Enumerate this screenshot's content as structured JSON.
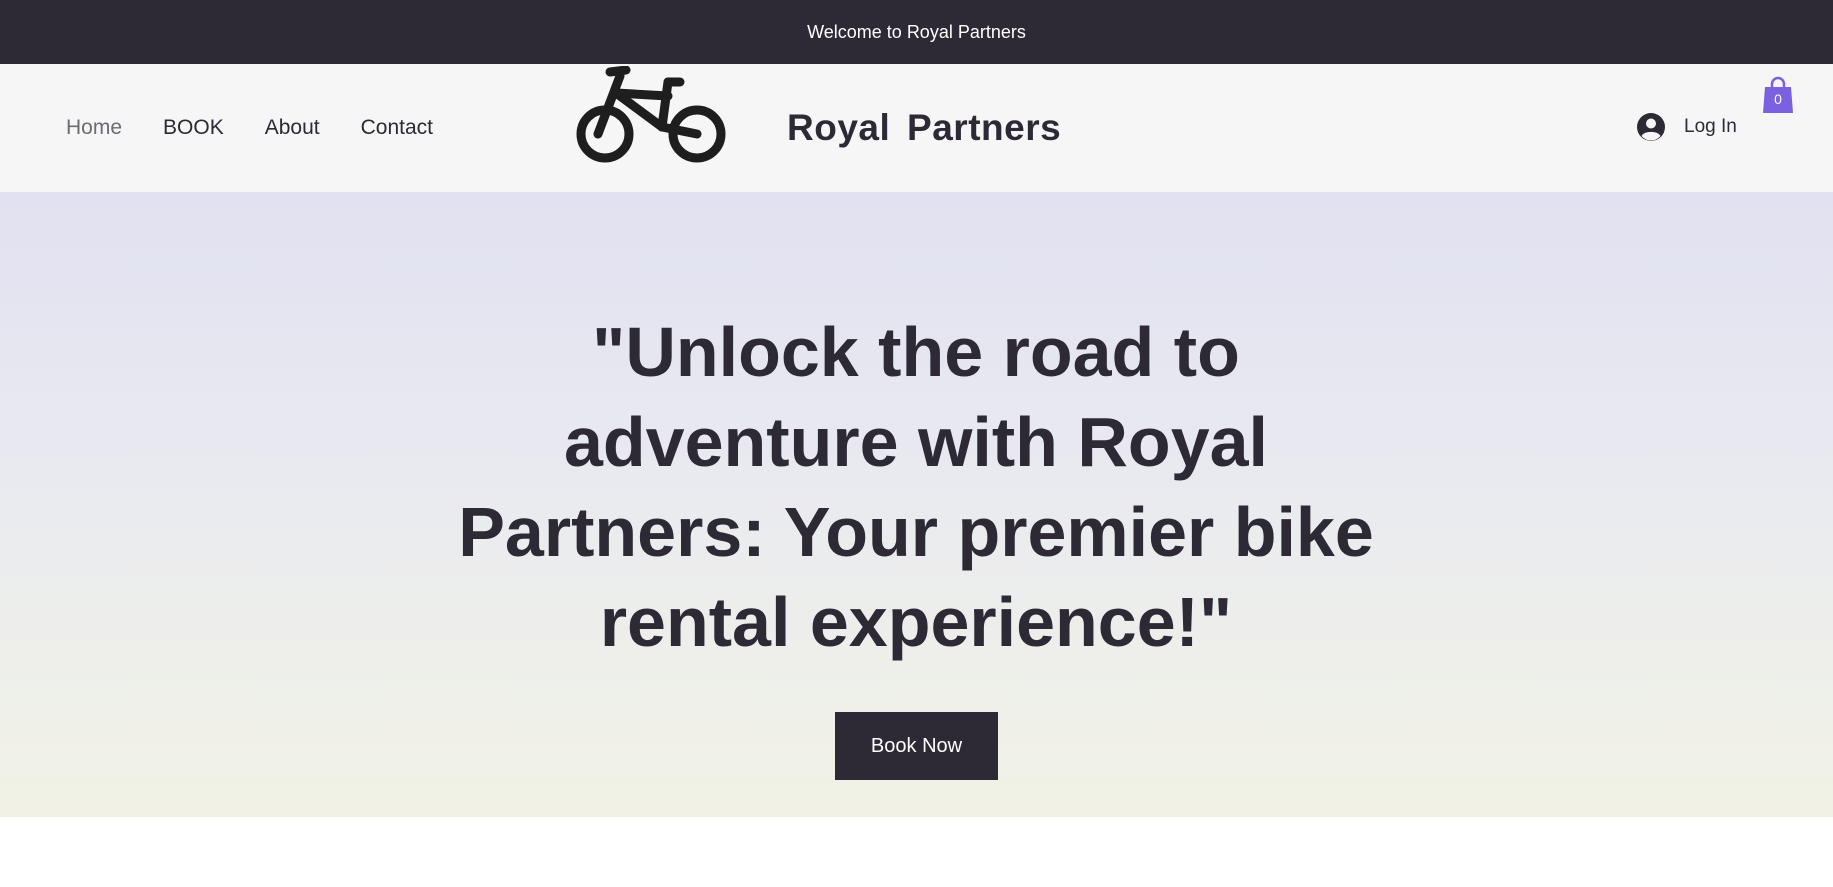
{
  "topbar": {
    "welcome": "Welcome to Royal Partners"
  },
  "nav": {
    "items": [
      {
        "label": "Home",
        "active": true
      },
      {
        "label": "BOOK"
      },
      {
        "label": "About"
      },
      {
        "label": "Contact"
      }
    ]
  },
  "logo": {
    "icon": "bicycle-icon"
  },
  "brand": {
    "name": "Royal  Partners"
  },
  "account": {
    "login_label": "Log In",
    "icon": "user-avatar-icon"
  },
  "cart": {
    "count": "0",
    "icon": "shopping-bag-icon",
    "color": "#7b61e0"
  },
  "hero": {
    "title": "\"Unlock the road to adventure with Royal Partners: Your premier bike rental experience!\"",
    "cta_label": "Book Now"
  },
  "colors": {
    "dark": "#2d2a35",
    "header_bg": "#f6f6f6",
    "hero_top": "#e1e1f1",
    "hero_bottom": "#f1f2e5"
  }
}
